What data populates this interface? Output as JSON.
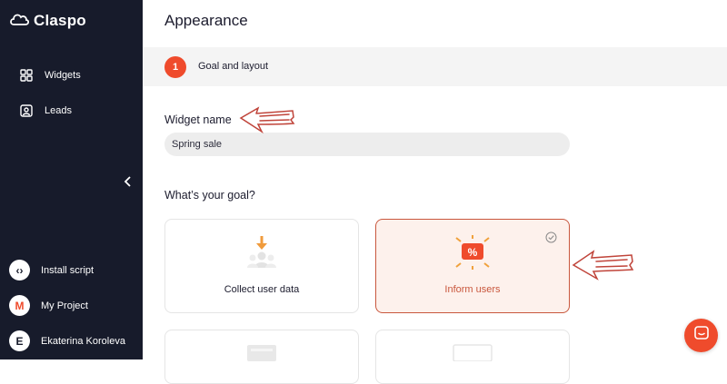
{
  "app": {
    "name": "Claspo"
  },
  "sidebar": {
    "items": [
      {
        "label": "Widgets",
        "icon": "grid-icon"
      },
      {
        "label": "Leads",
        "icon": "contact-icon"
      }
    ],
    "bottom": [
      {
        "label": "Install script",
        "icon": "code-icon",
        "glyph": "‹›"
      },
      {
        "label": "My Project",
        "icon": "project-logo",
        "glyph": "M"
      },
      {
        "label": "Ekaterina Koroleva",
        "icon": "user-avatar",
        "glyph": "E"
      }
    ]
  },
  "main": {
    "title": "Appearance",
    "step": {
      "number": "1",
      "label": "Goal and layout"
    },
    "widget_name": {
      "label": "Widget name",
      "value": "Spring sale"
    },
    "goal": {
      "label": "What’s your goal?",
      "options": [
        {
          "label": "Collect user data",
          "icon": "collect-data-icon",
          "selected": false
        },
        {
          "label": "Inform users",
          "icon": "inform-icon",
          "selected": true
        }
      ]
    }
  },
  "colors": {
    "accent": "#ef4b2c",
    "sidebar": "#171b2b",
    "selected_border": "#c9573d",
    "selected_bg": "#fdf1ec"
  }
}
